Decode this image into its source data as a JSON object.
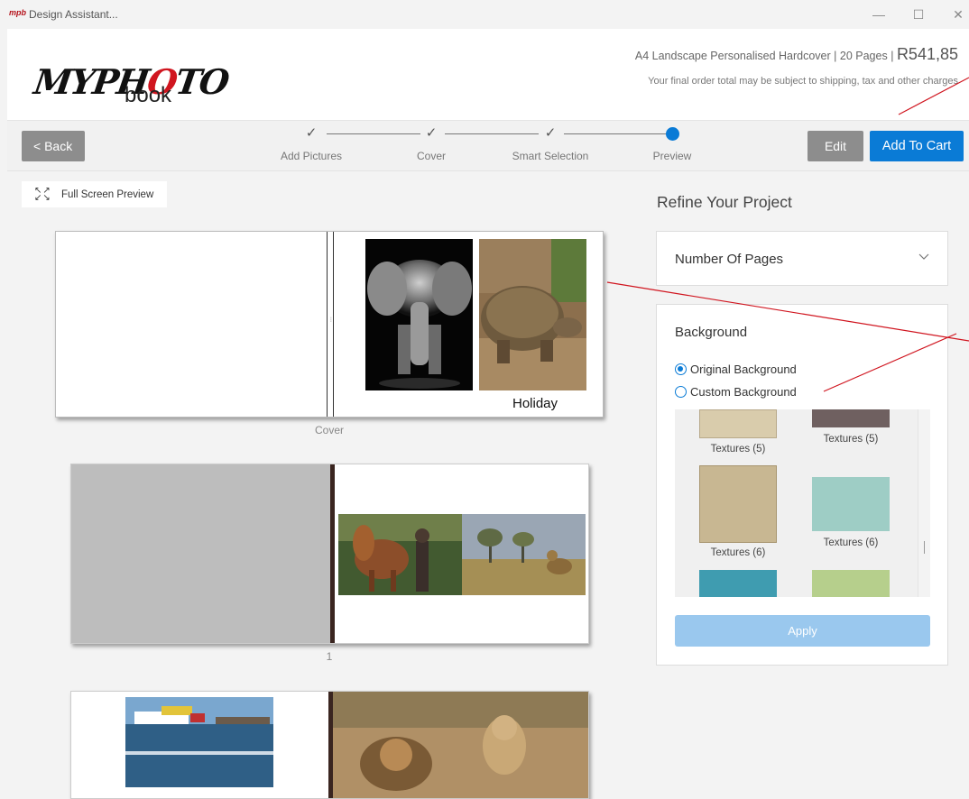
{
  "window": {
    "title": "Design Assistant...",
    "app_icon": "mpb",
    "controls": {
      "minimize": "—",
      "maximize": "☐",
      "close": "✕"
    }
  },
  "header": {
    "logo": {
      "my": "MY",
      "ph": "PH",
      "o": "O",
      "to": "TO",
      "book": "book"
    },
    "product": "A4 Landscape Personalised Hardcover",
    "sep1": "|",
    "pages": "20 Pages",
    "sep2": "|",
    "price": "R541,85",
    "disclaimer": "Your final order total may be subject to shipping, tax and other charges"
  },
  "toolbar": {
    "back_label": "< Back",
    "edit_label": "Edit",
    "cart_label": "Add To Cart",
    "steps": [
      {
        "label": "Add Pictures",
        "mark": "✓",
        "done": true
      },
      {
        "label": "Cover",
        "mark": "✓",
        "done": true
      },
      {
        "label": "Smart Selection",
        "mark": "✓",
        "done": true
      },
      {
        "label": "Preview",
        "mark": "",
        "done": false
      }
    ]
  },
  "preview": {
    "fullscreen_label": "Full Screen Preview",
    "fullscreen_icon": "expand-icon",
    "pages": [
      {
        "label": "Cover",
        "caption": "Holiday"
      },
      {
        "label": "1"
      },
      {
        "label": ""
      }
    ]
  },
  "refine": {
    "title": "Refine Your Project",
    "number_of_pages": {
      "label": "Number Of Pages",
      "icon": "chevron-down-icon"
    },
    "background": {
      "title": "Background",
      "options": [
        {
          "label": "Original Background",
          "selected": true
        },
        {
          "label": "Custom Background",
          "selected": false
        }
      ],
      "textures": [
        "Textures (5)",
        "Textures (5)",
        "Textures (6)",
        "Textures (6)"
      ],
      "apply_label": "Apply"
    }
  },
  "colors": {
    "accent": "#0a7bd6",
    "button_gray": "#8d8d8d",
    "apply_disabled": "#9ac8ee",
    "annotation": "#d0151f"
  }
}
